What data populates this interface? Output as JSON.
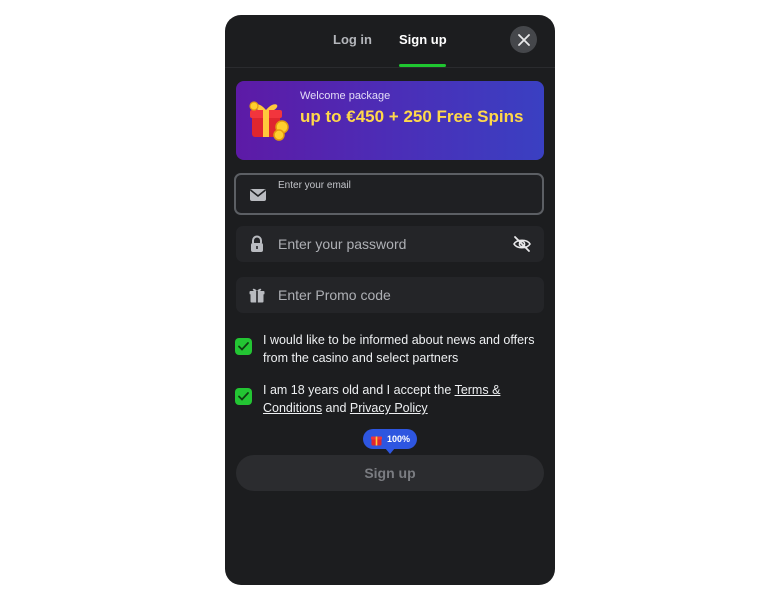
{
  "tabs": {
    "login": "Log in",
    "signup": "Sign up",
    "active": "signup"
  },
  "banner": {
    "kicker": "Welcome package",
    "headline": "up to €450 + 250 Free Spins"
  },
  "form": {
    "email_label": "Enter your email",
    "email_value": "",
    "password_placeholder": "Enter your password",
    "promo_placeholder": "Enter Promo code"
  },
  "consents": {
    "news_text": "I would like to be informed about news and offers from the casino and select partners",
    "age_prefix": "I am 18 years old and I accept the ",
    "terms_link": "Terms & Conditions",
    "and_text": " and ",
    "privacy_link": "Privacy Policy"
  },
  "badge": {
    "text": "100%"
  },
  "submit": {
    "label": "Sign up"
  },
  "colors": {
    "modal_bg": "#1c1d1f",
    "accent_green": "#1fc630",
    "banner_text": "#ffd84a",
    "badge_blue": "#2e56e0"
  },
  "icons": [
    "close-icon",
    "gift-icon",
    "envelope-icon",
    "lock-icon",
    "eye-off-icon",
    "checkmark-icon"
  ]
}
